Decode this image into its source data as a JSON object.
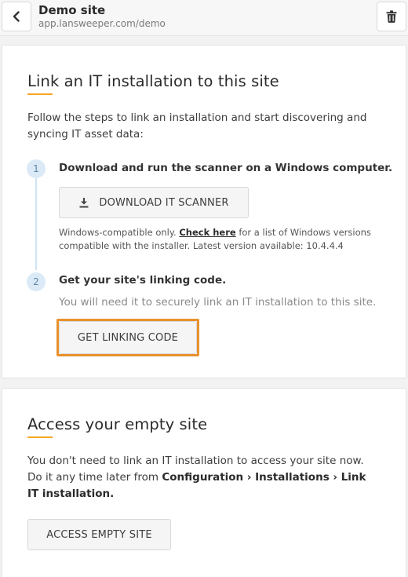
{
  "header": {
    "title": "Demo site",
    "url": "app.lansweeper.com/demo"
  },
  "link_section": {
    "title": "Link an IT installation to this site",
    "intro": "Follow the steps to link an installation and start discovering and syncing IT asset data:",
    "step1": {
      "number": "1",
      "title": "Download and run the scanner on a Windows computer.",
      "button_label": "DOWNLOAD IT SCANNER",
      "note_prefix": "Windows-compatible only. ",
      "note_link": "Check here",
      "note_suffix": " for a list of Windows versions compatible with the installer. Latest version available: 10.4.4.4"
    },
    "step2": {
      "number": "2",
      "title": "Get your site's linking code.",
      "description": "You will need it to securely link an IT installation to this site.",
      "button_label": "GET LINKING CODE"
    }
  },
  "empty_section": {
    "title": "Access your empty site",
    "text_prefix": "You don't need to link an IT installation to access your site now. Do it any time later from ",
    "path": "Configuration › Installations › Link IT installation.",
    "button_label": "ACCESS EMPTY SITE"
  },
  "colors": {
    "accent": "#f5a623",
    "highlight": "#e8912d",
    "step_bg": "#dbeaf6"
  },
  "icons": [
    "chevron-left-icon",
    "trash-icon",
    "download-icon"
  ]
}
